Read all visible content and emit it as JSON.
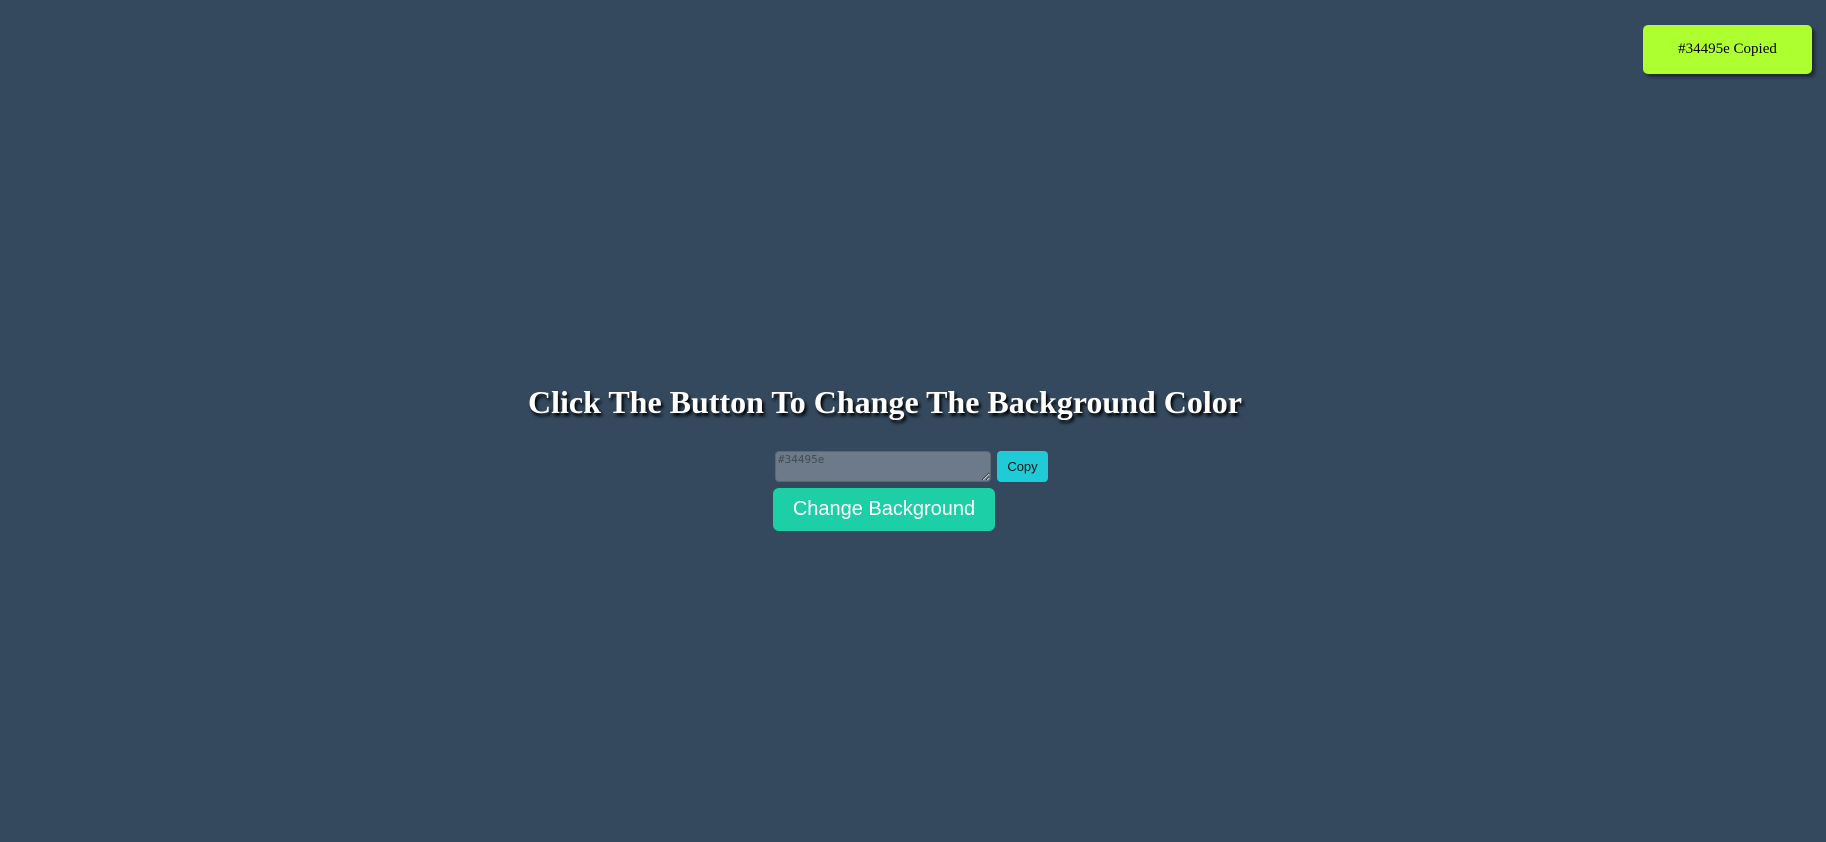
{
  "toast": {
    "message": "#34495e Copied",
    "color": "#adff2f"
  },
  "heading": {
    "text": "Click The Button To Change The Background Color"
  },
  "color_field": {
    "placeholder": "#34495e",
    "value": ""
  },
  "copy_button": {
    "label": "Copy",
    "color": "#1ecbd6"
  },
  "change_button": {
    "label": "Change Background",
    "color": "#1ccfa6"
  },
  "page": {
    "background_color": "#34495e"
  }
}
